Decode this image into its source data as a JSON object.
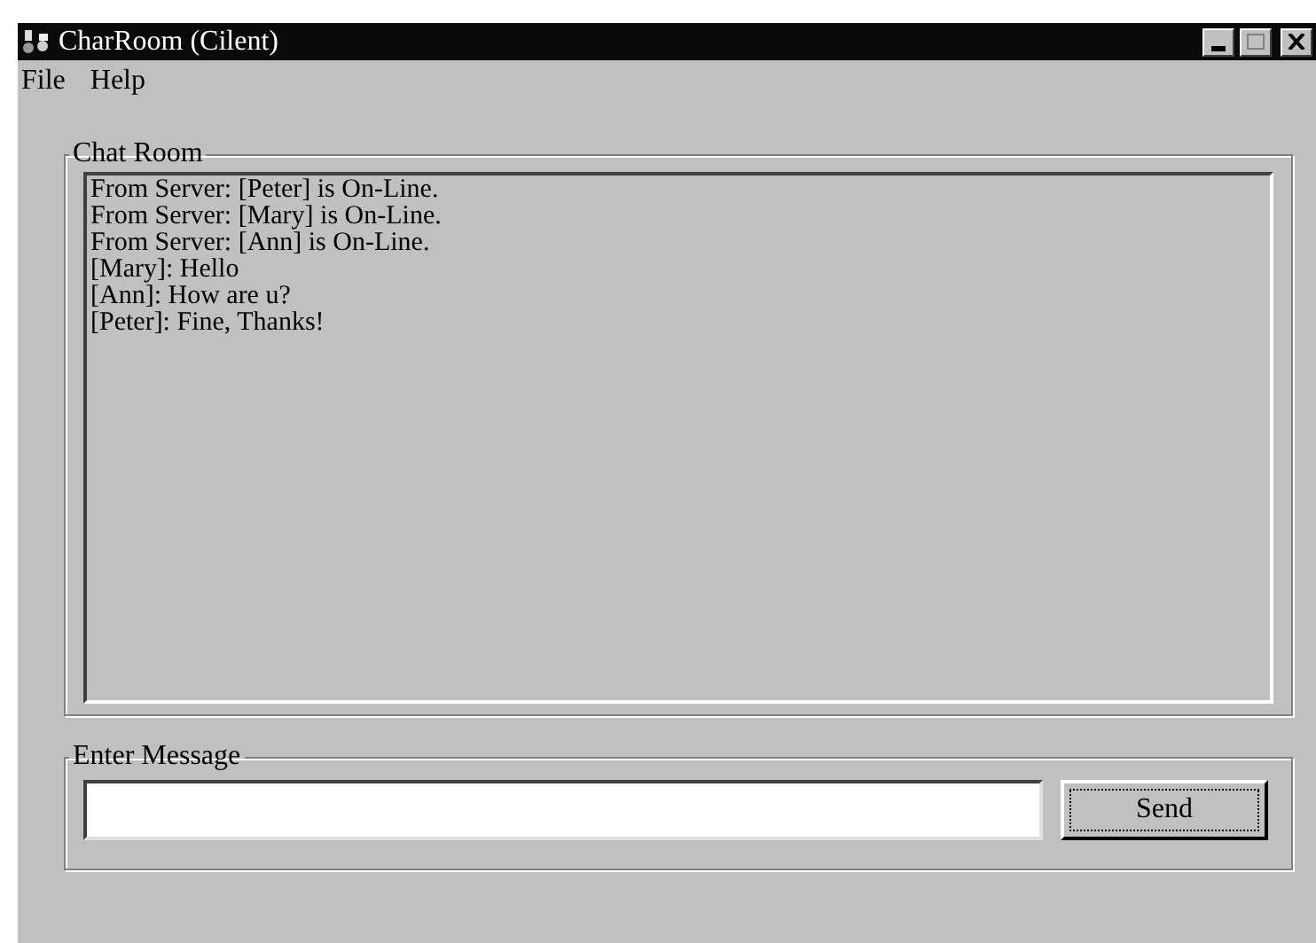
{
  "window": {
    "title": "CharRoom (Cilent)"
  },
  "menu": [
    "File",
    "Help"
  ],
  "chat_room": {
    "label": "Chat Room",
    "lines": [
      "From Server: [Peter] is On-Line.",
      "From Server: [Mary] is On-Line.",
      "From Server: [Ann] is On-Line.",
      "[Mary]: Hello",
      "[Ann]: How are u?",
      "[Peter]: Fine, Thanks!"
    ]
  },
  "enter_message": {
    "label": "Enter Message",
    "button": "Send"
  }
}
